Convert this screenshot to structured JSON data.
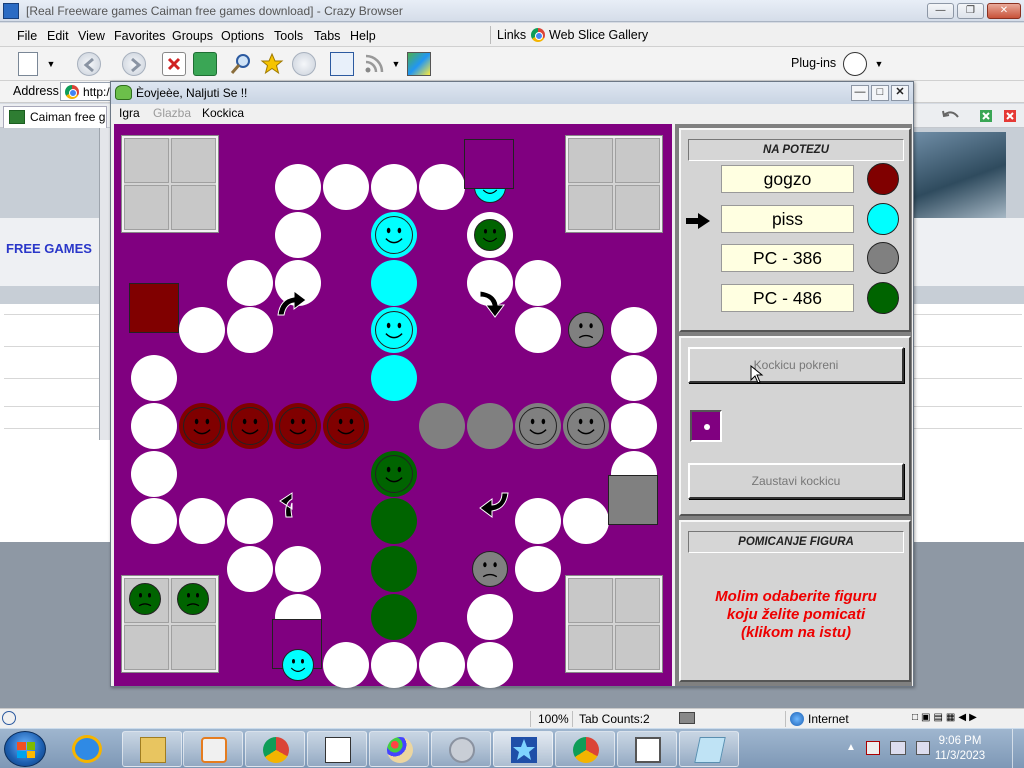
{
  "browser": {
    "title": "[Real Freeware games Caiman free games download] - Crazy Browser",
    "menu": [
      "File",
      "Edit",
      "View",
      "Favorites",
      "Groups",
      "Options",
      "Tools",
      "Tabs",
      "Help"
    ],
    "links_label": "Links",
    "web_slice_gallery": "Web Slice Gallery",
    "plugins_label": "Plug-ins",
    "address_label": "Address",
    "address_value": "http:/",
    "tab_label": "Caiman free g"
  },
  "webpage": {
    "free_games": "FREE GAMES"
  },
  "game": {
    "title": "Èovjeèe, Naljuti Se !!",
    "menu": [
      "Igra",
      "Glazba",
      "Kockica"
    ],
    "turn_header": "NA POTEZU",
    "players": [
      {
        "name": "gogzo",
        "color": "#800000"
      },
      {
        "name": "piss",
        "color": "#00ffff"
      },
      {
        "name": "PC - 386",
        "color": "#808080"
      },
      {
        "name": "PC - 486",
        "color": "#006400"
      }
    ],
    "current_player_index": 1,
    "roll_button": "Kockicu pokreni",
    "stop_button": "Zaustavi kockicu",
    "dice_value": 1,
    "move_header": "POMICANJE FIGURA",
    "message_lines": [
      "Molim odaberite figuru",
      "koju želite pomicati",
      "(klikom na istu)"
    ]
  },
  "status": {
    "zoom": "100%",
    "tab_counts": "Tab Counts:2",
    "zone": "Internet"
  },
  "taskbar": {
    "time": "9:06 PM",
    "date": "11/3/2023"
  },
  "colors": {
    "board": "#800080",
    "red": "#800000",
    "cyan": "#00ffff",
    "gray": "#808080",
    "green": "#006400"
  }
}
